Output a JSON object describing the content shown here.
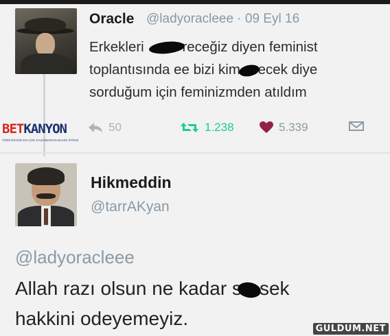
{
  "tweet1": {
    "name": "Oracle",
    "handle_date": "@ladyoracleee · 09 Eyl 16",
    "text_parts": [
      "Erkekleri ",
      "receğiz diyen feminist\ntoplantısında ee bizi kim ",
      "ecek diye\nsorduğum için feminizmden atıldım"
    ],
    "actions": {
      "reply_count": "50",
      "retweet_count": "1.238",
      "like_count": "5.339"
    },
    "colors": {
      "retweet": "#19cf86",
      "like": "#8f2445",
      "handle": "#8899a6"
    }
  },
  "logo": {
    "part1": "BET",
    "part2": "KANYON",
    "tagline": "TÜRKİYE'NİN EN ÇOK KAZANDIRAN BAHİS SİTESİ"
  },
  "tweet2": {
    "name": "Hikmeddin",
    "handle": "@tarrAKyan",
    "mention": "@ladyoracleee",
    "text_parts": [
      "Allah razı olsun ne kadar s",
      "sek\nhakkini odeyemeyiz."
    ]
  },
  "watermark": "GULDUM.NET"
}
